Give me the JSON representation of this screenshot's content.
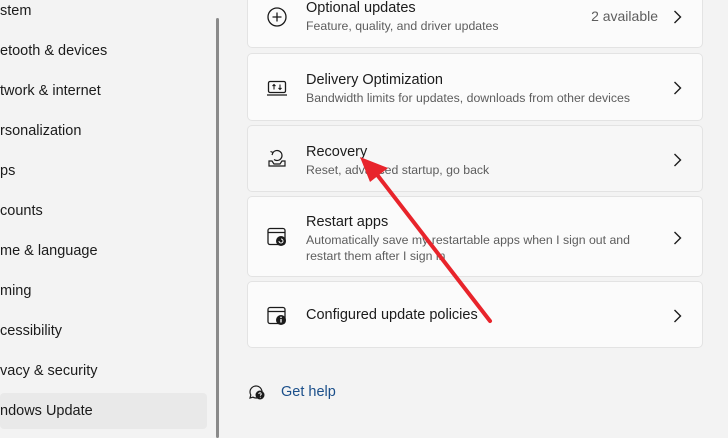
{
  "sidebar": {
    "items": [
      {
        "label": "stem"
      },
      {
        "label": "etooth & devices"
      },
      {
        "label": "twork & internet"
      },
      {
        "label": "rsonalization"
      },
      {
        "label": "ps"
      },
      {
        "label": "counts"
      },
      {
        "label": "me & language"
      },
      {
        "label": "ming"
      },
      {
        "label": "cessibility"
      },
      {
        "label": "vacy & security"
      },
      {
        "label": "ndows Update"
      }
    ]
  },
  "cards": [
    {
      "title": "Optional updates",
      "desc": "Feature, quality, and driver updates",
      "extra": "2 available",
      "icon": "plus-circle-icon"
    },
    {
      "title": "Delivery Optimization",
      "desc": "Bandwidth limits for updates, downloads from other devices",
      "icon": "delivery-optimization-icon"
    },
    {
      "title": "Recovery",
      "desc": "Reset, advanced startup, go back",
      "icon": "recovery-icon"
    },
    {
      "title": "Restart apps",
      "desc": "Automatically save my restartable apps when I sign out and restart them after I sign in",
      "icon": "restart-apps-icon"
    },
    {
      "title": "Configured update policies",
      "desc": "",
      "icon": "policy-info-icon"
    }
  ],
  "help": {
    "label": "Get help",
    "icon": "help-icon"
  },
  "annotation": {
    "color": "#e8242b",
    "icon": "red-arrow"
  }
}
